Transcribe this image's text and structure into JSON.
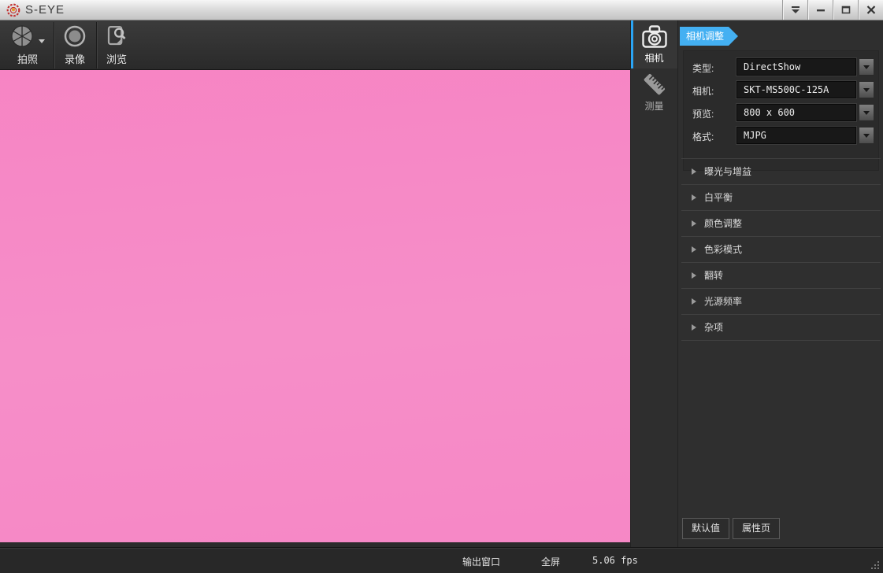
{
  "window": {
    "title": "S-EYE",
    "controls": {
      "menu": "window-menu",
      "minimize": "minimize",
      "maximize": "maximize",
      "close": "close"
    }
  },
  "toolbar": {
    "capture_label": "拍照",
    "record_label": "录像",
    "browse_label": "浏览",
    "icons": [
      "aperture-icon",
      "record-icon",
      "browse-icon"
    ]
  },
  "preview": {
    "color": "#f587c5",
    "description": "live camera feed, uniform pink frame"
  },
  "side_tabs": [
    {
      "label": "相机",
      "icon": "camera-icon",
      "active": true
    },
    {
      "label": "测量",
      "icon": "ruler-icon",
      "active": false
    }
  ],
  "panel": {
    "header": "相机调整",
    "fields": [
      {
        "label": "类型:",
        "value": "DirectShow"
      },
      {
        "label": "相机:",
        "value": "SKT-MS500C-125A"
      },
      {
        "label": "预览:",
        "value": "800 x 600"
      },
      {
        "label": "格式:",
        "value": "MJPG"
      }
    ],
    "sections": [
      "曝光与增益",
      "白平衡",
      "颜色调整",
      "色彩模式",
      "翻转",
      "光源频率",
      "杂项"
    ],
    "buttons": [
      {
        "label": "默认值"
      },
      {
        "label": "属性页"
      }
    ]
  },
  "statusbar": {
    "output_window": "输出窗口",
    "fullscreen": "全屏",
    "fps": "5.06 fps"
  },
  "colors": {
    "accent_blue": "#44b0f2",
    "tab_accent": "#2aa4f4",
    "preview_pink": "#f587c5",
    "panel_bg": "#2f2f2f",
    "titlebar_text": "#3a3a3a"
  }
}
